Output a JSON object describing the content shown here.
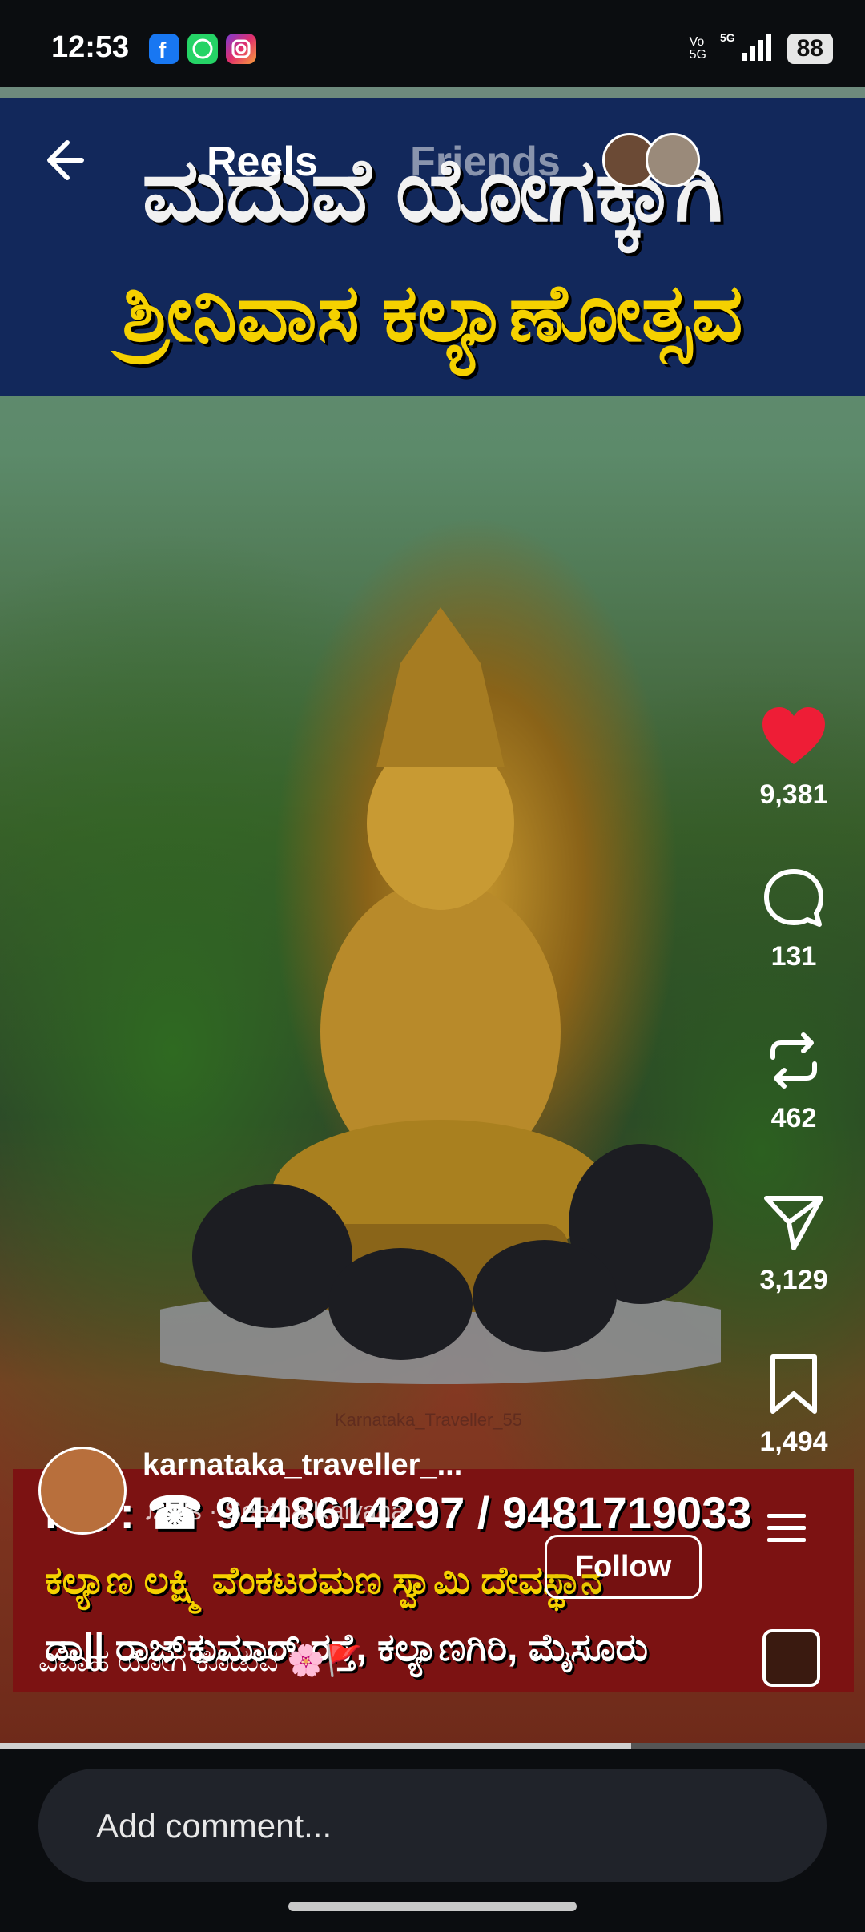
{
  "status_bar": {
    "time": "12:53",
    "network": "5G",
    "volte": "Vo 5G",
    "battery": "88",
    "notification_icons": [
      "facebook-icon",
      "whatsapp-icon",
      "instagram-icon"
    ]
  },
  "header": {
    "tabs": [
      {
        "label": "Reels",
        "active": true
      },
      {
        "label": "Friends",
        "active": false
      }
    ]
  },
  "video": {
    "banner_top_line1": "ಮದುವೆ ಯೋಗಕ್ಕಾಗಿ",
    "banner_top_line2": "ಶ್ರೀನಿವಾಸ ಕಲ್ಯಾಣೋತ್ಸವ",
    "watermark": "Karnataka_Traveller_55",
    "banner_bottom_phone": "PH : ☎ 9448614297 / 9481719033",
    "banner_bottom_temple": "ಕಲ್ಯಾಣ ಲಕ್ಷ್ಮಿ ವೆಂಕಟರಮಣ ಸ್ವಾಮಿ ದೇವಸ್ಥಾನ",
    "banner_bottom_address": "ಡಾ|| ರಾಜ್‌ಕುಮಾರ್ ರಸ್ತೆ, ಕಲ್ಯಾಣಗಿರಿ, ಮೈಸೂರು",
    "progress": 0.73
  },
  "actions": {
    "likes": "9,381",
    "comments": "131",
    "reposts": "462",
    "shares": "3,129",
    "saves": "1,494"
  },
  "post": {
    "username": "karnataka_traveller_...",
    "music": "♫ als · Seetha Kalyana",
    "follow_label": "Follow",
    "caption": "ವಿವಾಹ ಯೋಗ ಕೊಡುವ 🌸🚩"
  },
  "comment_bar": {
    "placeholder": "Add comment..."
  },
  "colors": {
    "like_red": "#ee1d36",
    "banner_navy": "#12285b",
    "banner_red": "#7c1212",
    "banner_yellow": "#f5d100"
  }
}
